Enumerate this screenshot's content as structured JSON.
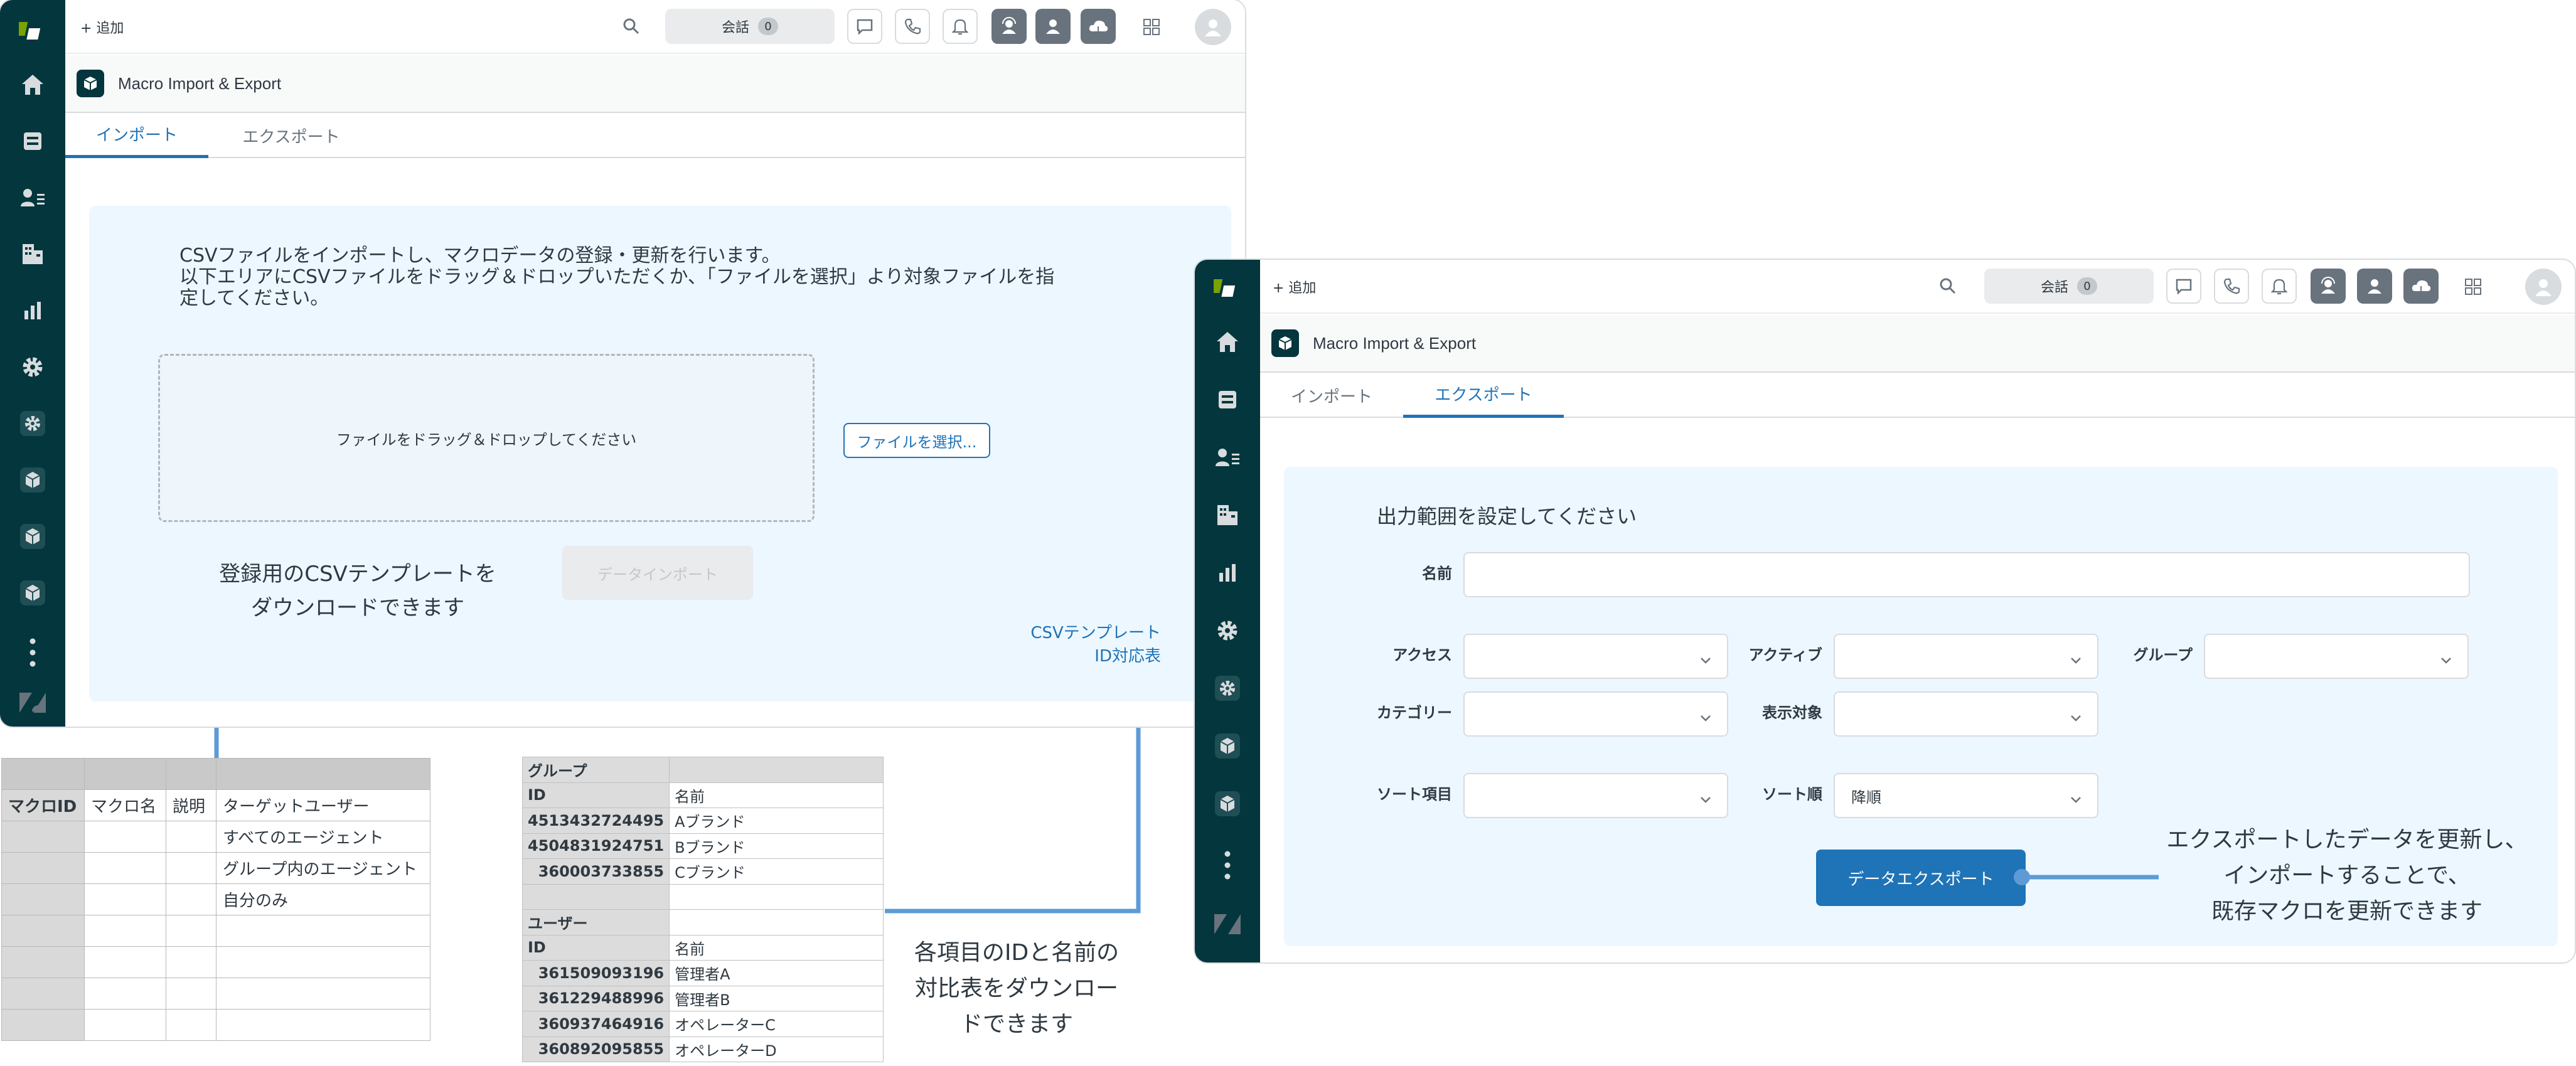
{
  "topbar": {
    "add_label": "+ 追加",
    "conversations_label": "会話",
    "conversations_count": "0"
  },
  "app": {
    "title": "Macro Import & Export"
  },
  "tabs": [
    "インポート",
    "エクスポート"
  ],
  "import_panel": {
    "line1": "CSVファイルをインポートし、マクロデータの登録・更新を行います。",
    "line2": "以下エリアにCSVファイルをドラッグ＆ドロップいただくか、「ファイルを選択」より対象ファイルを指",
    "line3": "定してください。",
    "dropzone_text": "ファイルをドラッグ＆ドロップしてください",
    "choose_file_button": "ファイルを選択...",
    "import_button": "データインポート",
    "csv_template_link": "CSVテンプレート",
    "id_table_link": "ID対応表"
  },
  "export_panel": {
    "heading": "出力範囲を設定してください",
    "name_label": "名前",
    "access_label": "アクセス",
    "active_label": "アクティブ",
    "group_label": "グループ",
    "category_label": "カテゴリー",
    "display_target_label": "表示対象",
    "sort_item_label": "ソート項目",
    "sort_order_label": "ソート順",
    "sort_order_value": "降順",
    "export_button": "データエクスポート"
  },
  "annotations": {
    "template_line1": "登録用のCSVテンプレートを",
    "template_line2": "ダウンロードできます",
    "idtable_line1": "各項目のIDと名前の",
    "idtable_line2": "対比表をダウンロー",
    "idtable_line3": "ドできます",
    "export_line1": "エクスポートしたデータを更新し、",
    "export_line2": "インポートすることで、",
    "export_line3": "既存マクロを更新できます"
  },
  "template_sheet": {
    "headers": [
      "マクロID",
      "マクロ名",
      "説明",
      "ターゲットユーザー"
    ],
    "target_values": [
      "すべてのエージェント",
      "グループ内のエージェント",
      "自分のみ"
    ]
  },
  "id_sheet": {
    "group_title": "グループ",
    "group_headers": [
      "ID",
      "名前"
    ],
    "groups": [
      {
        "id": "4513432724495",
        "name": "Aブランド"
      },
      {
        "id": "4504831924751",
        "name": "Bブランド"
      },
      {
        "id": "360003733855",
        "name": "Cブランド"
      }
    ],
    "user_title": "ユーザー",
    "user_headers": [
      "ID",
      "名前"
    ],
    "users": [
      {
        "id": "361509093196",
        "name": "管理者A"
      },
      {
        "id": "361229488996",
        "name": "管理者B"
      },
      {
        "id": "360937464916",
        "name": "オペレーターC"
      },
      {
        "id": "360892095855",
        "name": "オペレーターD"
      }
    ]
  },
  "colors": {
    "rail": "#03363d",
    "accent": "#1f73b7",
    "connector": "#5c9bd5",
    "panel_bg": "#edf7ff",
    "logo_green": "#78a300"
  }
}
